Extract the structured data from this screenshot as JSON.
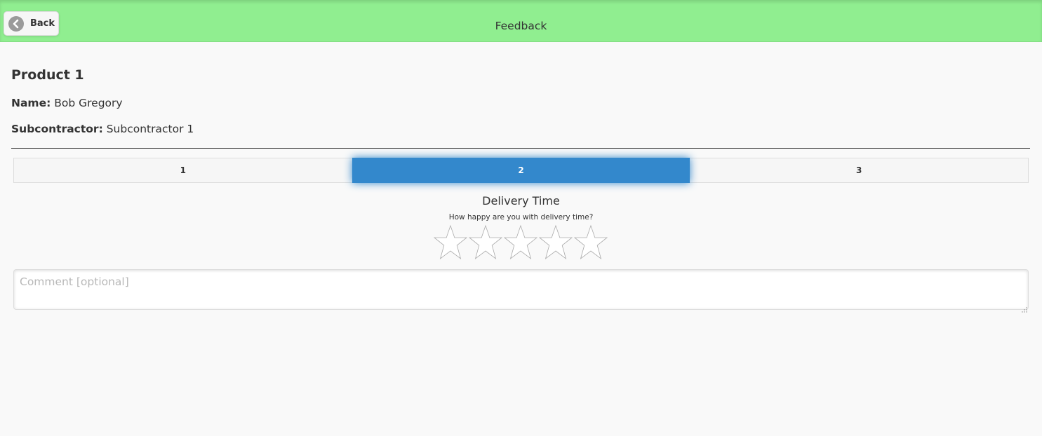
{
  "header": {
    "back_label": "Back",
    "title": "Feedback",
    "background": "#90ee90"
  },
  "product": {
    "title": "Product 1",
    "name_label": "Name:",
    "name_value": "Bob Gregory",
    "subcontractor_label": "Subcontractor:",
    "subcontractor_value": "Subcontractor 1"
  },
  "tabs": [
    {
      "label": "1",
      "active": false
    },
    {
      "label": "2",
      "active": true
    },
    {
      "label": "3",
      "active": false
    }
  ],
  "question": {
    "title": "Delivery Time",
    "subtitle": "How happy are you with delivery time?",
    "rating": 0,
    "max_rating": 5
  },
  "comment": {
    "placeholder": "Comment [optional]",
    "value": ""
  },
  "colors": {
    "accent": "#3388cc",
    "star_outline": "#aaaaaa"
  },
  "icons": {
    "back": "chevron-left-icon",
    "star": "star-outline-icon"
  }
}
